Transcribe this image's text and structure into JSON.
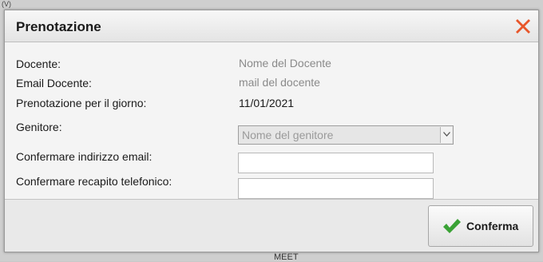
{
  "background": {
    "top_fragment": "(V)",
    "bottom_fragment": "MEET"
  },
  "dialog": {
    "title": "Prenotazione",
    "close_icon": "close-x-icon",
    "fields": {
      "teacher_label": "Docente:",
      "teacher_value": "Nome del Docente",
      "teacher_email_label": "Email Docente:",
      "teacher_email_value": "mail del docente",
      "date_label": "Prenotazione per il giorno:",
      "date_value": "11/01/2021",
      "parent_label": "Genitore:",
      "parent_value": "Nome del genitore",
      "confirm_email_label": "Confermare indirizzo email:",
      "confirm_email_value": "",
      "confirm_phone_label": "Confermare recapito telefonico:",
      "confirm_phone_value": ""
    },
    "confirm_button": {
      "label": "Conferma",
      "icon": "checkmark-icon"
    }
  },
  "colors": {
    "close_icon": "#e8562a",
    "checkmark": "#3aa235",
    "muted_text": "#8a8a8a"
  }
}
